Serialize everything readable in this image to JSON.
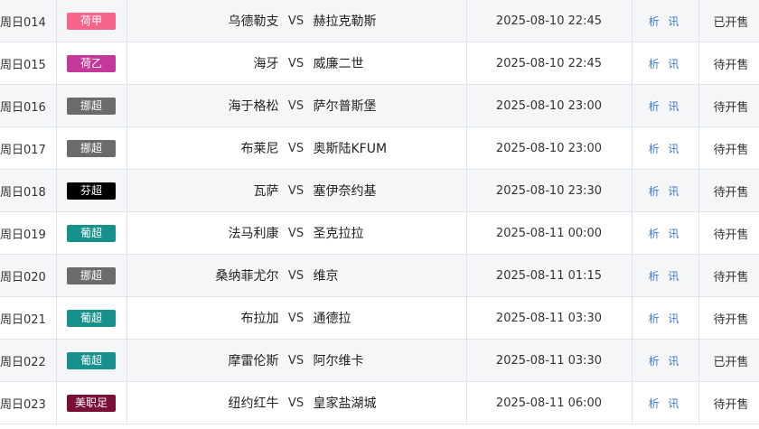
{
  "vs_label": "VS",
  "matches": [
    {
      "num": "周日014",
      "league": "荷甲",
      "league_color": "#f7648c",
      "home": "乌德勒支",
      "away": "赫拉克勒斯",
      "time": "2025-08-10 22:45",
      "info": "析 讯",
      "status": "已开售"
    },
    {
      "num": "周日015",
      "league": "荷乙",
      "league_color": "#c3389a",
      "home": "海牙",
      "away": "威廉二世",
      "time": "2025-08-10 22:45",
      "info": "析 讯",
      "status": "待开售"
    },
    {
      "num": "周日016",
      "league": "挪超",
      "league_color": "#6b6b6b",
      "home": "海于格松",
      "away": "萨尔普斯堡",
      "time": "2025-08-10 23:00",
      "info": "析 讯",
      "status": "待开售"
    },
    {
      "num": "周日017",
      "league": "挪超",
      "league_color": "#6b6b6b",
      "home": "布莱尼",
      "away": "奥斯陆KFUM",
      "time": "2025-08-10 23:00",
      "info": "析 讯",
      "status": "待开售"
    },
    {
      "num": "周日018",
      "league": "芬超",
      "league_color": "#000000",
      "home": "瓦萨",
      "away": "塞伊奈约基",
      "time": "2025-08-10 23:30",
      "info": "析 讯",
      "status": "待开售"
    },
    {
      "num": "周日019",
      "league": "葡超",
      "league_color": "#15908a",
      "home": "法马利康",
      "away": "圣克拉拉",
      "time": "2025-08-11 00:00",
      "info": "析 讯",
      "status": "待开售"
    },
    {
      "num": "周日020",
      "league": "挪超",
      "league_color": "#6b6b6b",
      "home": "桑纳菲尤尔",
      "away": "维京",
      "time": "2025-08-11 01:15",
      "info": "析 讯",
      "status": "待开售"
    },
    {
      "num": "周日021",
      "league": "葡超",
      "league_color": "#15908a",
      "home": "布拉加",
      "away": "通德拉",
      "time": "2025-08-11 03:30",
      "info": "析 讯",
      "status": "待开售"
    },
    {
      "num": "周日022",
      "league": "葡超",
      "league_color": "#15908a",
      "home": "摩雷伦斯",
      "away": "阿尔维卡",
      "time": "2025-08-11 03:30",
      "info": "析 讯",
      "status": "已开售"
    },
    {
      "num": "周日023",
      "league": "美职足",
      "league_color": "#7a0f3a",
      "home": "纽约红牛",
      "away": "皇家盐湖城",
      "time": "2025-08-11 06:00",
      "info": "析 讯",
      "status": "待开售"
    }
  ]
}
